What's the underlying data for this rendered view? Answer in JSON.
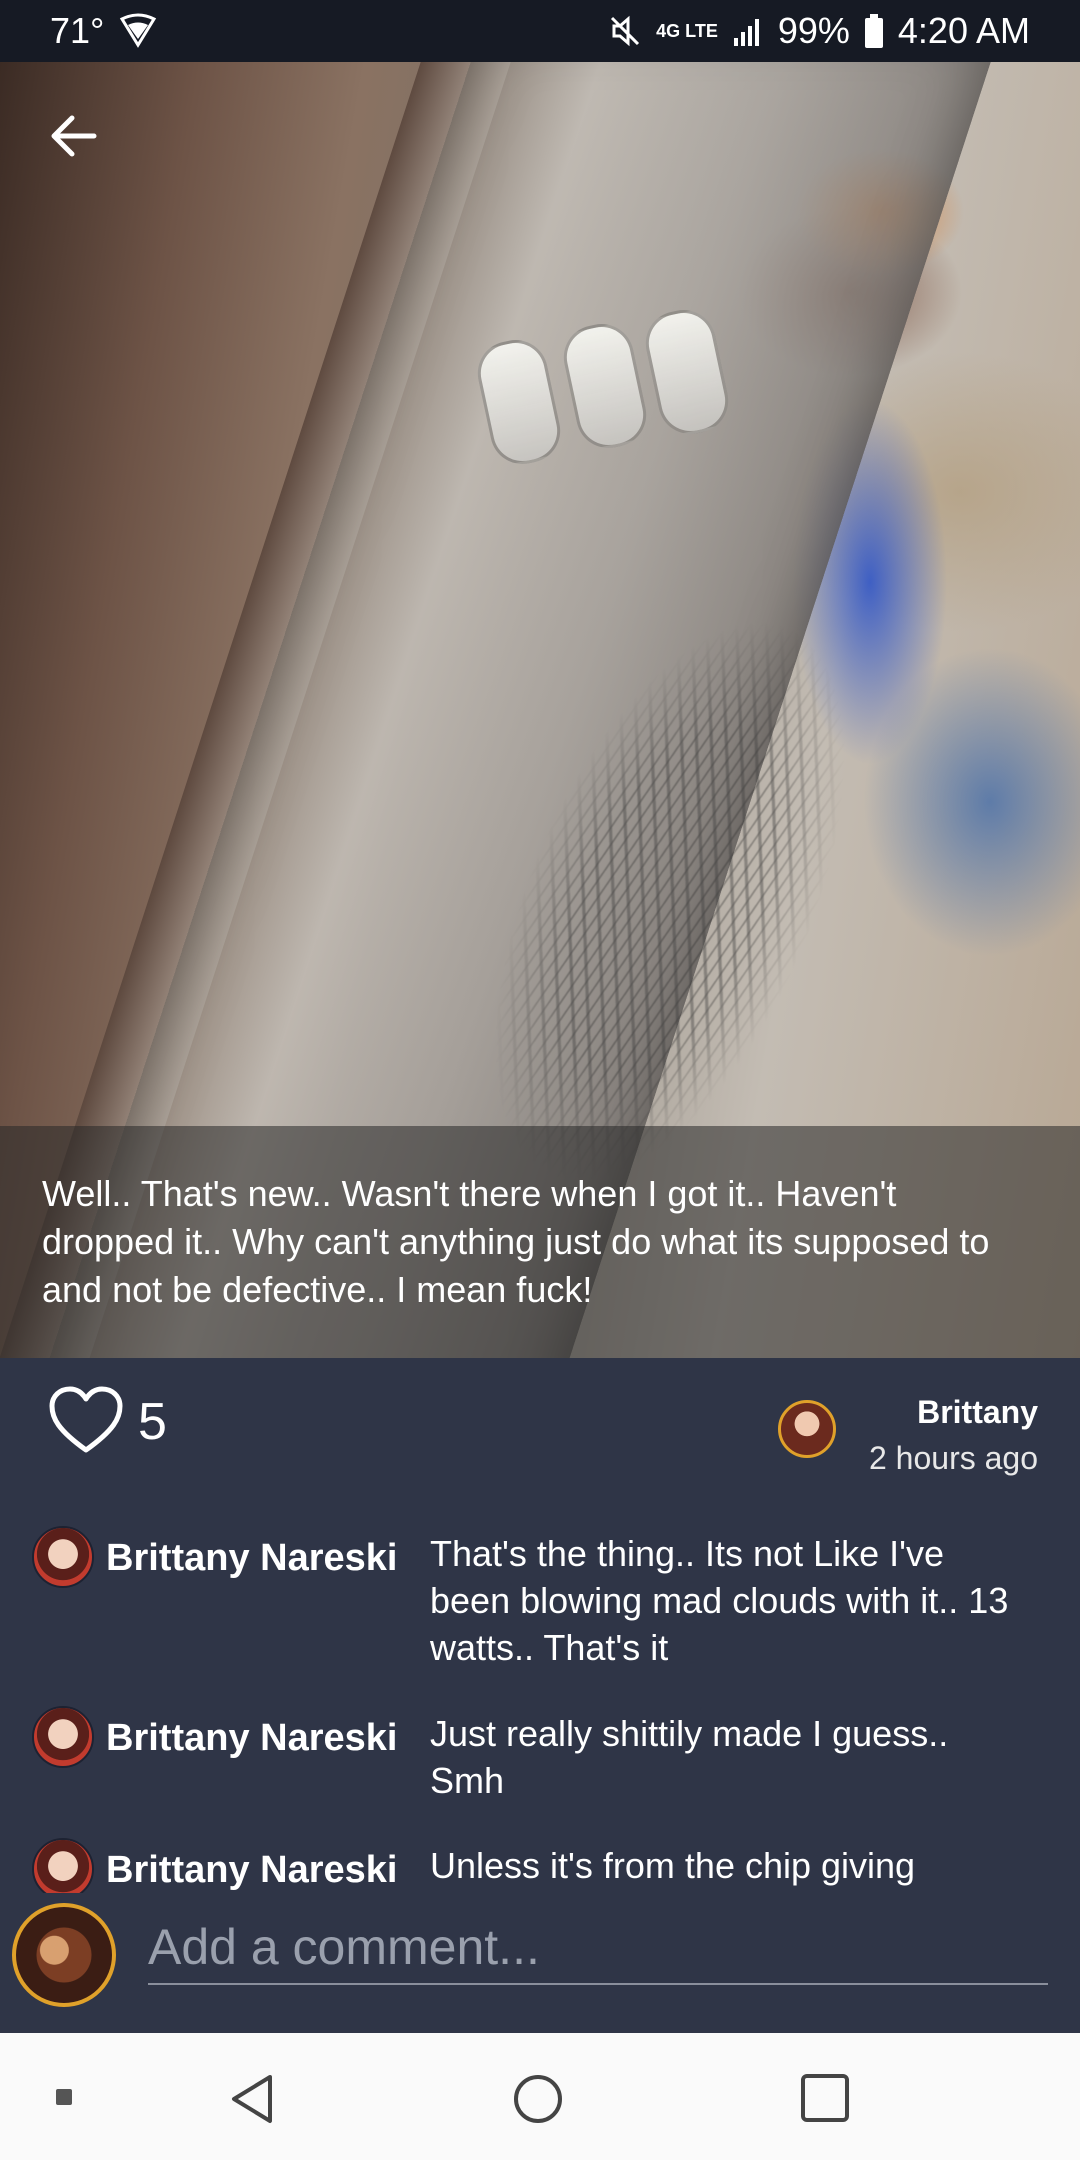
{
  "status_bar": {
    "temperature": "71°",
    "network_label": "4G LTE",
    "battery": "99%",
    "time": "4:20 AM"
  },
  "post": {
    "caption": "Well.. That's new.. Wasn't there when I got it.. Haven't dropped it.. Why can't anything just do what its supposed to and not be defective.. I mean fuck!",
    "like_count": "5",
    "author_name": "Brittany",
    "posted_time": "2 hours ago"
  },
  "comments": [
    {
      "author": "Brittany Nareski",
      "text": "That's the thing.. Its not Like I've been blowing mad clouds with it.. 13 watts.. That's it"
    },
    {
      "author": "Brittany Nareski",
      "text": "Just really shittily made I guess.. Smh"
    },
    {
      "author": "Brittany Nareski",
      "text": "Unless it's from the chip giving"
    }
  ],
  "compose": {
    "placeholder": "Add a comment..."
  },
  "colors": {
    "background": "#2f3547",
    "status_bar": "#161a24",
    "avatar_ring": "#e0a12a",
    "nav_bar": "#fafafa"
  },
  "icons": [
    "back-arrow-icon",
    "heart-icon",
    "wifi-icon",
    "mute-icon",
    "signal-icon",
    "battery-icon",
    "nav-back-icon",
    "nav-home-icon",
    "nav-recents-icon"
  ]
}
